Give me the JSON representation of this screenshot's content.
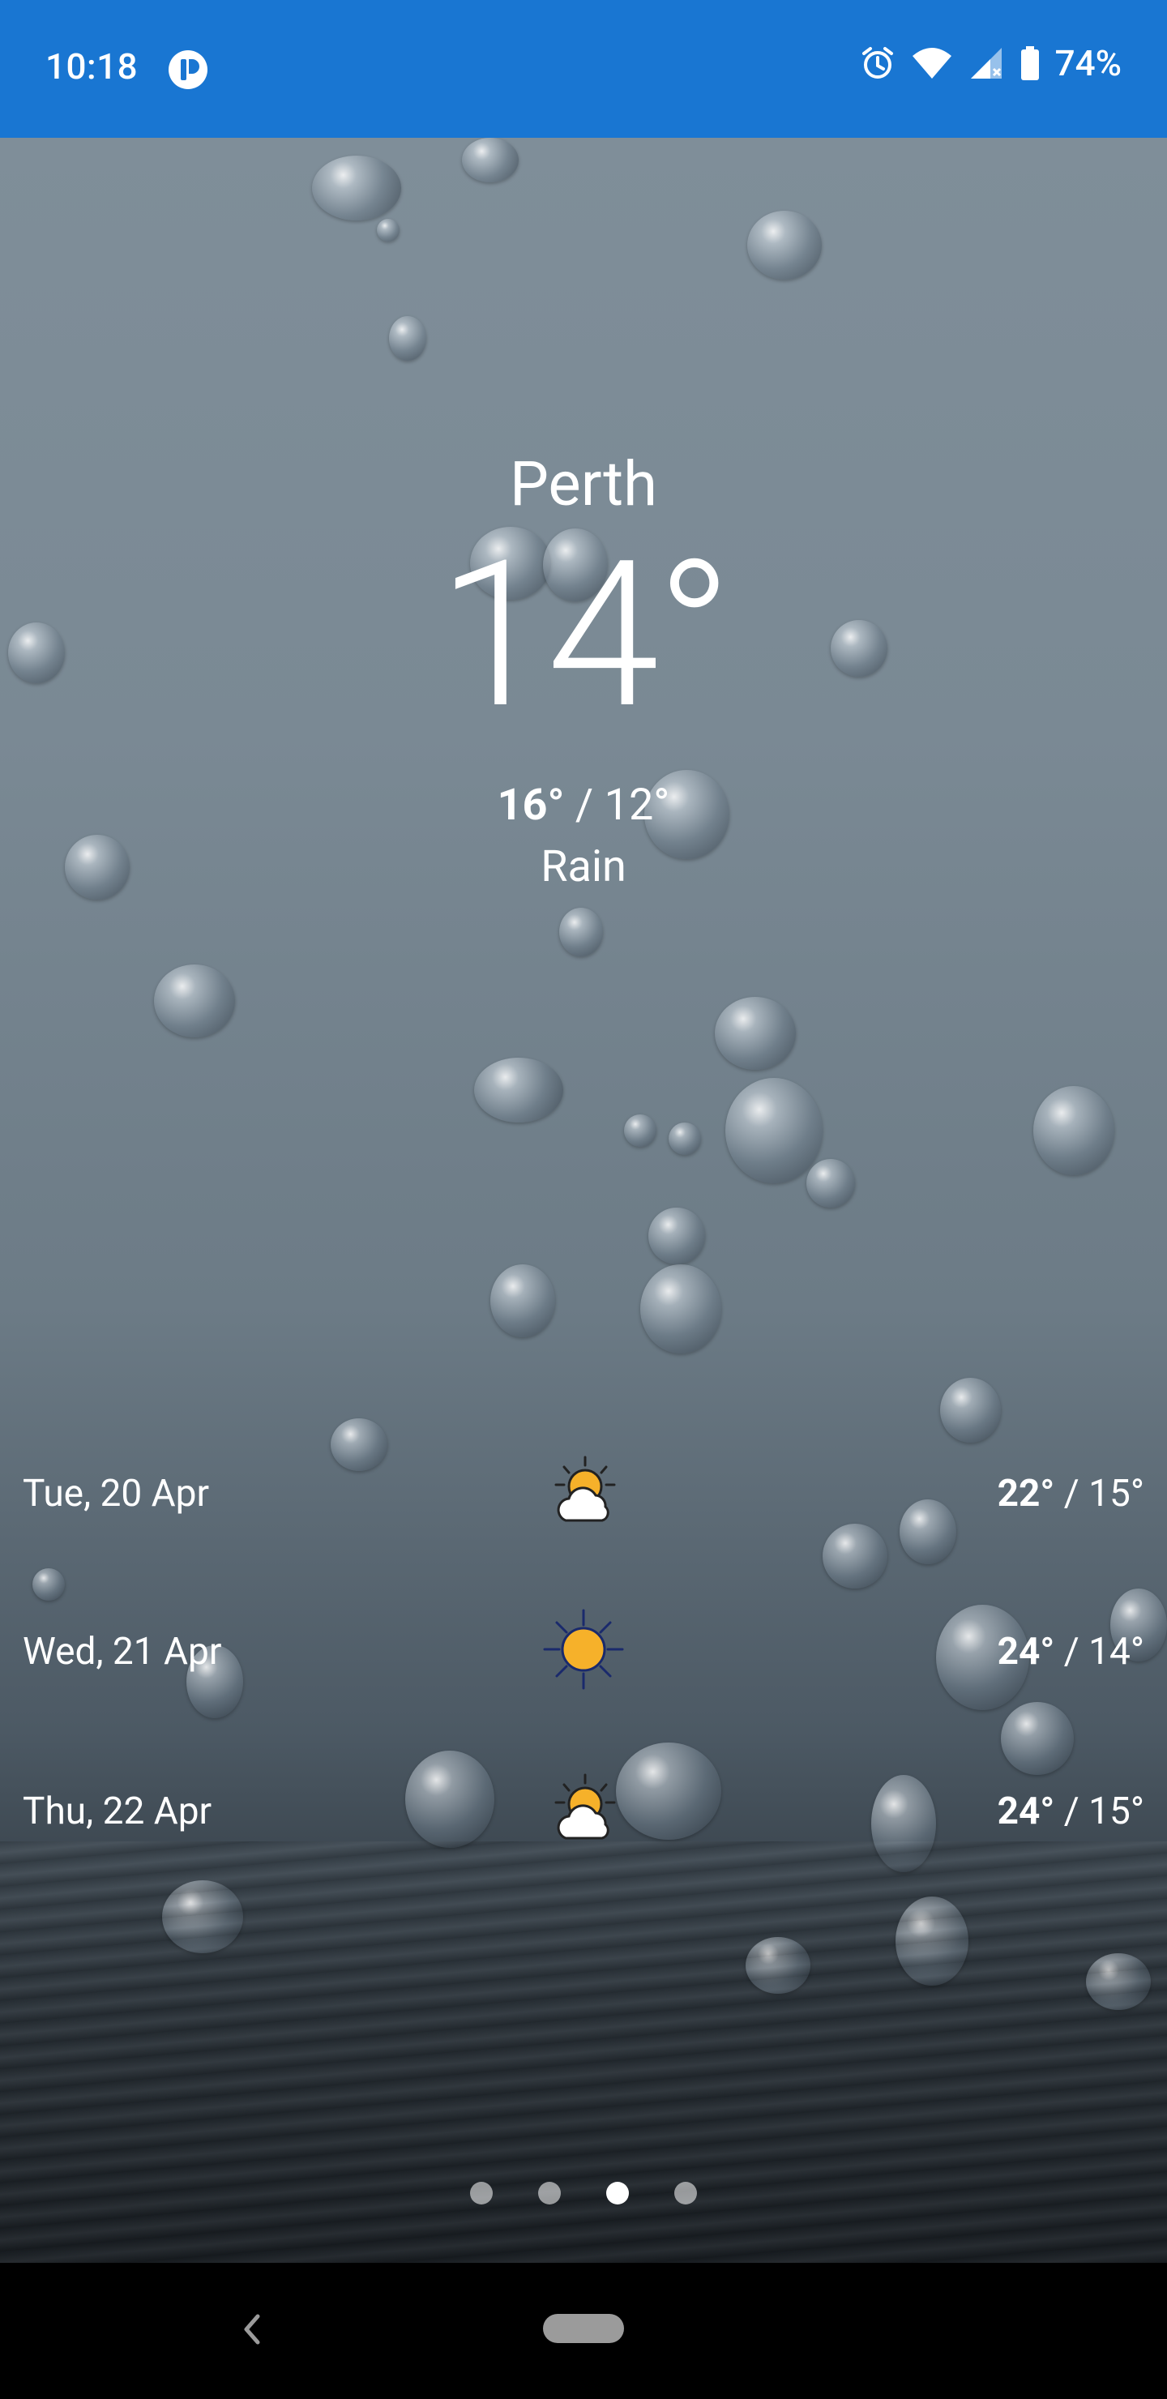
{
  "status_bar": {
    "time": "10:18",
    "battery": "74%",
    "background": "#1976d2"
  },
  "weather": {
    "city": "Perth",
    "temperature": "14°",
    "high": "16°",
    "low": "12°",
    "condition": "Rain"
  },
  "forecast": [
    {
      "date": "Tue, 20 Apr",
      "high": "22°",
      "low": "15°",
      "icon": "partly-cloudy-icon"
    },
    {
      "date": "Wed, 21 Apr",
      "high": "24°",
      "low": "14°",
      "icon": "sun-icon"
    },
    {
      "date": "Thu, 22 Apr",
      "high": "24°",
      "low": "15°",
      "icon": "partly-cloudy-icon"
    }
  ],
  "pager": {
    "count": 4,
    "active": 3
  }
}
